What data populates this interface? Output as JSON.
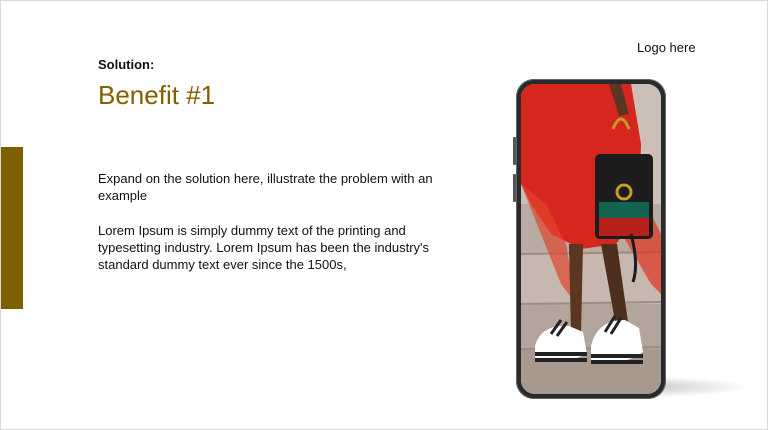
{
  "slide": {
    "logo_text": "Logo here",
    "solution_label": "Solution:",
    "benefit_title": "Benefit #1",
    "paragraph_1": "Expand on the solution here, illustrate the problem with an example",
    "paragraph_2": "Lorem Ipsum is simply dummy text of the printing and typesetting industry. Lorem Ipsum has been the industry's standard dummy text ever since the 1500s,"
  },
  "colors": {
    "accent": "#7f6000",
    "title": "#806000"
  },
  "phone_image": {
    "description_icon": "fashion-photo-icon"
  }
}
